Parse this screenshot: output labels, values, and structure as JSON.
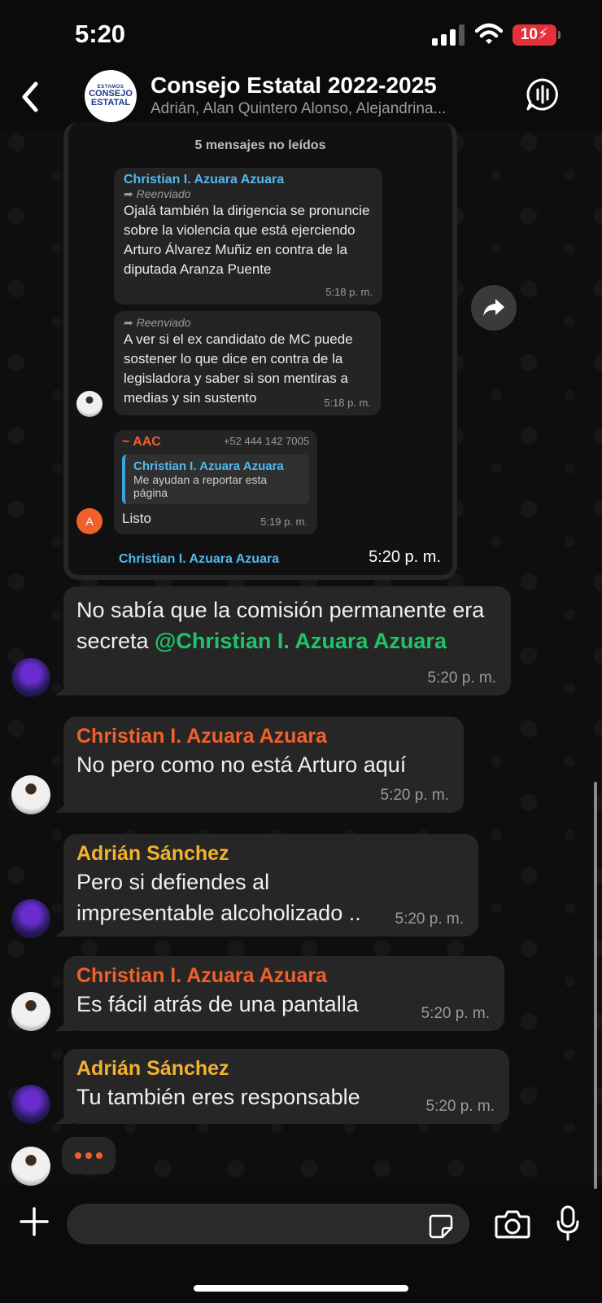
{
  "status_bar": {
    "time": "5:20",
    "battery": "10"
  },
  "header": {
    "avatar_small": "ESTAMOS",
    "avatar_line1": "CONSEJO",
    "avatar_line2": "ESTATAL",
    "title": "Consejo Estatal 2022-2025",
    "members": "Adrián, Alan Quintero Alonso, Alejandrina..."
  },
  "screenshot": {
    "unread": "5 mensajes no leídos",
    "msg1": {
      "sender": "Christian I. Azuara Azuara",
      "forwarded": "Reenviado",
      "text": "Ojalá también la dirigencia se pronuncie sobre la violencia que está ejerciendo Arturo Álvarez Muñiz en contra de la diputada Aranza Puente",
      "time": "5:18 p. m."
    },
    "msg2": {
      "forwarded": "Reenviado",
      "text": "A ver si el ex candidato de MC puede sostener lo que dice en contra de la legisladora y saber si son mentiras a medias y sin sustento",
      "time": "5:18 p. m."
    },
    "msg3": {
      "sender": "~ AAC",
      "phone": "+52 444 142 7005",
      "quote_sender": "Christian I. Azuara Azuara",
      "quote_text": "Me ayudan a reportar esta página",
      "text": "Listo",
      "time": "5:19 p. m.",
      "avatar_letter": "A"
    },
    "cut_sender": "Christian I. Azuara Azuara",
    "time": "5:20 p. m."
  },
  "messages": [
    {
      "sender": "",
      "text": "No sabía que la comisión permanente era secreta ",
      "mention": "@Christian I. Azuara Azuara",
      "time": "5:20 p. m."
    },
    {
      "sender": "Christian I. Azuara Azuara",
      "text": "No pero como no está Arturo aquí",
      "time": "5:20 p. m."
    },
    {
      "sender": "Adrián Sánchez",
      "text": "Pero si defiendes al impresentable alcoholizado ..",
      "time": "5:20 p. m."
    },
    {
      "sender": "Christian I. Azuara Azuara",
      "text": "Es fácil atrás de una pantalla",
      "time": "5:20 p. m."
    },
    {
      "sender": "Adrián Sánchez",
      "text": "Tu también eres responsable",
      "time": "5:20 p. m."
    }
  ],
  "colors": {
    "christian": "#f0602a",
    "adrian": "#f2b12e",
    "mention": "#1fc36a",
    "quote_accent": "#3aa4e0",
    "inner_sender": "#53b7ef"
  },
  "composer": {
    "placeholder": ""
  }
}
